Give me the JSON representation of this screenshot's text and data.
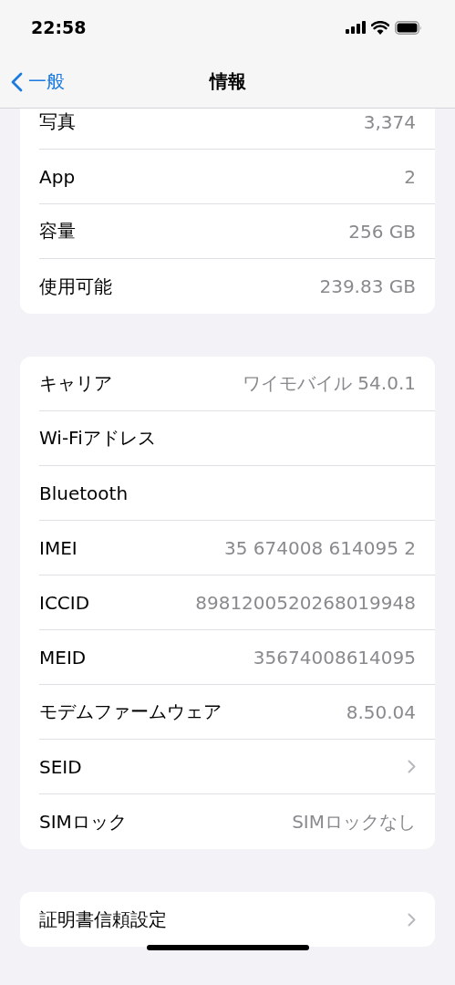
{
  "status_bar": {
    "time": "22:58"
  },
  "nav": {
    "back_label": "一般",
    "title": "情報"
  },
  "sections": [
    {
      "rows": [
        {
          "label": "写真",
          "value": "3,374",
          "chevron": false
        },
        {
          "label": "App",
          "value": "2",
          "chevron": false
        },
        {
          "label": "容量",
          "value": "256 GB",
          "chevron": false
        },
        {
          "label": "使用可能",
          "value": "239.83 GB",
          "chevron": false
        }
      ]
    },
    {
      "rows": [
        {
          "label": "キャリア",
          "value": "ワイモバイル 54.0.1",
          "chevron": false
        },
        {
          "label": "Wi-Fiアドレス",
          "chevron": false
        },
        {
          "label": "Bluetooth",
          "chevron": false
        },
        {
          "label": "IMEI",
          "value": "35 674008 614095 2",
          "chevron": false
        },
        {
          "label": "ICCID",
          "value": "8981200520268019948",
          "chevron": false
        },
        {
          "label": "MEID",
          "value": "35674008614095",
          "chevron": false
        },
        {
          "label": "モデムファームウェア",
          "value": "8.50.04",
          "chevron": false
        },
        {
          "label": "SEID",
          "chevron": true
        },
        {
          "label": "SIMロック",
          "value": "SIMロックなし",
          "chevron": false
        }
      ]
    },
    {
      "rows": [
        {
          "label": "証明書信頼設定",
          "chevron": true
        }
      ]
    }
  ]
}
